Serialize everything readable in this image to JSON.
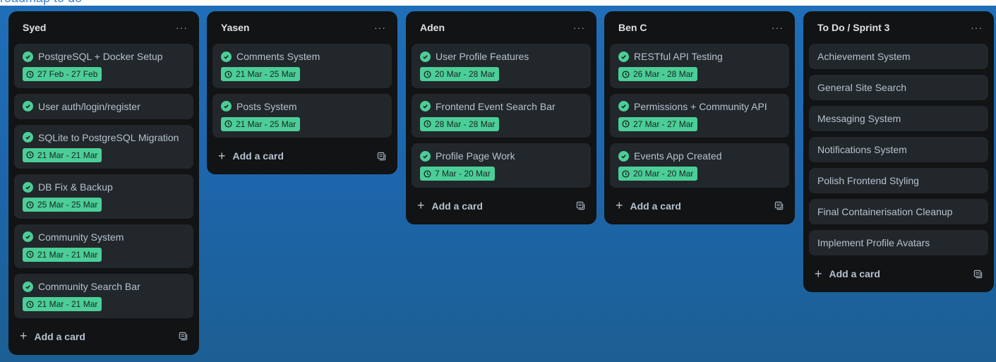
{
  "header": {
    "partial_text": "roadmap to do"
  },
  "colors": {
    "board_bg": "#1f6fb8",
    "list_bg": "#111314",
    "card_bg": "#22272b",
    "badge_green": "#4bce97"
  },
  "lists": [
    {
      "title": "Syed",
      "menu": "···",
      "cards": [
        {
          "title": "PostgreSQL + Docker Setup",
          "date": "27 Feb - 27 Feb"
        },
        {
          "title": "User auth/login/register",
          "date": ""
        },
        {
          "title": "SQLite to PostgreSQL Migration",
          "date": "21 Mar - 21 Mar"
        },
        {
          "title": "DB Fix & Backup",
          "date": "25 Mar - 25 Mar"
        },
        {
          "title": "Community System",
          "date": "21 Mar - 21 Mar"
        },
        {
          "title": "Community Search Bar",
          "date": "21 Mar - 21 Mar"
        }
      ],
      "add_label": "Add a card"
    },
    {
      "title": "Yasen",
      "menu": "···",
      "cards": [
        {
          "title": "Comments System",
          "date": "21 Mar - 25 Mar"
        },
        {
          "title": "Posts System",
          "date": "21 Mar - 25 Mar"
        }
      ],
      "add_label": "Add a card"
    },
    {
      "title": "Aden",
      "menu": "···",
      "cards": [
        {
          "title": "User Profile Features",
          "date": "20 Mar - 28 Mar"
        },
        {
          "title": "Frontend Event Search Bar",
          "date": "28 Mar - 28 Mar"
        },
        {
          "title": "Profile Page Work",
          "date": "7 Mar - 20 Mar"
        }
      ],
      "add_label": "Add a card"
    },
    {
      "title": "Ben C",
      "menu": "···",
      "cards": [
        {
          "title": "RESTful API Testing",
          "date": "26 Mar - 28 Mar"
        },
        {
          "title": "Permissions + Community API",
          "date": "27 Mar - 27 Mar"
        },
        {
          "title": "Events App Created",
          "date": "20 Mar - 20 Mar"
        }
      ],
      "add_label": "Add a card"
    },
    {
      "title": "To Do / Sprint 3",
      "menu": "···",
      "plain_cards": [
        "Achievement System",
        "General Site Search",
        "Messaging System",
        "Notifications System",
        "Polish Frontend Styling",
        "Final Containerisation Cleanup",
        "Implement Profile Avatars"
      ],
      "add_label": "Add a card"
    }
  ],
  "icons": {
    "check": "check-circle-icon",
    "clock": "clock-icon",
    "plus": "plus-icon",
    "template": "card-template-icon",
    "menu": "more-horizontal-icon"
  }
}
